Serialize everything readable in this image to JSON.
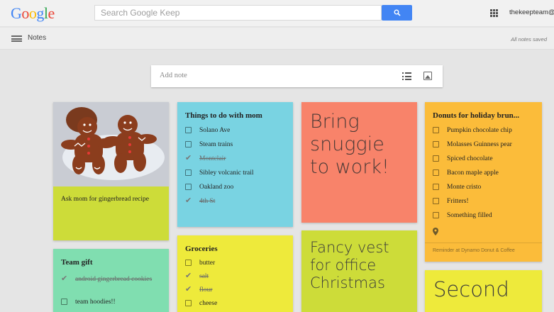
{
  "header": {
    "logo": "Google",
    "search_placeholder": "Search Google Keep",
    "account": "thekeepteam@g"
  },
  "subbar": {
    "section": "Notes",
    "status": "All notes saved"
  },
  "composer": {
    "placeholder": "Add note"
  },
  "notes": {
    "gingerbread": {
      "text": "Ask mom for gingerbread recipe",
      "color": "#cddc39"
    },
    "team_gift": {
      "title": "Team gift",
      "color": "#80deb0",
      "items": [
        {
          "text": "android gingerbread cookies",
          "done": true
        },
        {
          "text": "team hoodies!!",
          "done": false
        }
      ]
    },
    "mom": {
      "title": "Things to do with mom",
      "color": "#79d3e2",
      "items": [
        {
          "text": "Solano Ave",
          "done": false
        },
        {
          "text": "Steam trains",
          "done": false
        },
        {
          "text": "Montclair",
          "done": true
        },
        {
          "text": "Sibley volcanic trail",
          "done": false
        },
        {
          "text": "Oakland zoo",
          "done": false
        },
        {
          "text": "4th St",
          "done": true
        }
      ]
    },
    "groceries": {
      "title": "Groceries",
      "color": "#eeea3b",
      "items": [
        {
          "text": "butter",
          "done": false
        },
        {
          "text": "salt",
          "done": true
        },
        {
          "text": "flour",
          "done": true
        },
        {
          "text": "cheese",
          "done": false
        }
      ]
    },
    "snuggie": {
      "text": "Bring snuggie to work!",
      "color": "#f8836a"
    },
    "fancy_vest": {
      "text": "Fancy vest for office Christmas",
      "color": "#cddc39"
    },
    "donuts": {
      "title": "Donuts for holiday brun...",
      "color": "#fbbc3a",
      "items": [
        {
          "text": "Pumpkin chocolate chip",
          "done": false
        },
        {
          "text": "Molasses Guinness pear",
          "done": false
        },
        {
          "text": "Spiced chocolate",
          "done": false
        },
        {
          "text": "Bacon maple apple",
          "done": false
        },
        {
          "text": "Monte cristo",
          "done": false
        },
        {
          "text": "Fritters!",
          "done": false
        },
        {
          "text": "Something filled",
          "done": false
        }
      ],
      "reminder": "Reminder at Dynamo Donut & Coffee"
    },
    "second": {
      "text": "Second",
      "color": "#eeea3b"
    }
  }
}
